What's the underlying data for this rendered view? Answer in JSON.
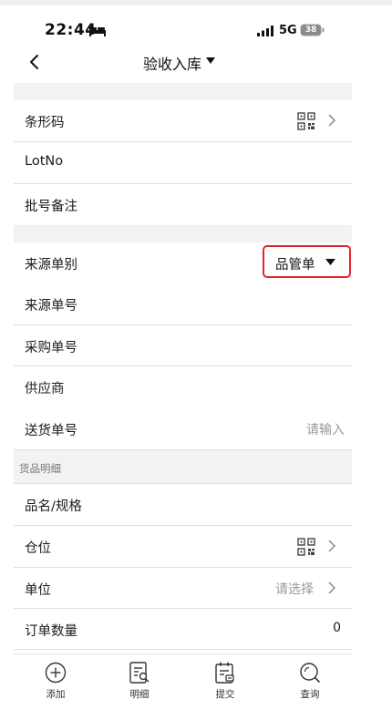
{
  "status_bar": {
    "time": "22:44",
    "network": "5G",
    "battery": "38",
    "icons": [
      "bed-icon",
      "signal-icon",
      "battery-icon"
    ]
  },
  "nav": {
    "title": "验收入库",
    "icons": [
      "back-icon",
      "caret-down-icon"
    ]
  },
  "group1": [
    {
      "label": "条形码",
      "icons": [
        "qr-scan-icon",
        "chevron-right-icon"
      ]
    },
    {
      "label": "LotNo"
    },
    {
      "label": "批号备注"
    }
  ],
  "group2": {
    "source_type": {
      "label": "来源单别",
      "selected": "品管单"
    },
    "rows": [
      {
        "label": "来源单号"
      },
      {
        "label": "采购单号"
      },
      {
        "label": "供应商"
      },
      {
        "label": "送货单号",
        "placeholder": "请输入"
      }
    ]
  },
  "details": {
    "section_title": "货品明细",
    "rows": [
      {
        "label": "品名/规格"
      },
      {
        "label": "仓位",
        "icons": [
          "qr-scan-icon",
          "chevron-right-icon"
        ]
      },
      {
        "label": "单位",
        "hint": "请选择"
      },
      {
        "label": "订单数量",
        "value": "0"
      }
    ]
  },
  "tabbar": [
    {
      "label": "添加",
      "icon": "add-circle-icon"
    },
    {
      "label": "明细",
      "icon": "detail-list-icon"
    },
    {
      "label": "提交",
      "icon": "submit-calendar-icon"
    },
    {
      "label": "查询",
      "icon": "search-icon"
    }
  ],
  "colors": {
    "highlight_border": "#e4262c",
    "section_background": "#f2f2f2",
    "placeholder_text": "#9a9a9a"
  }
}
